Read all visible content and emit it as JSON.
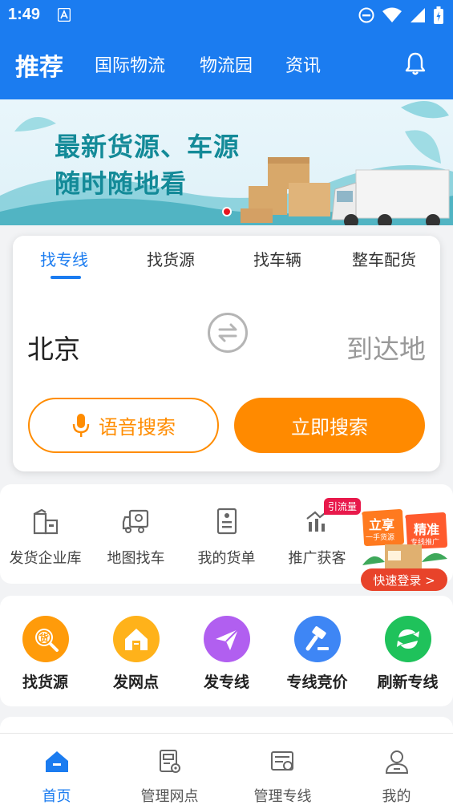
{
  "status_bar": {
    "time": "1:49"
  },
  "top_nav": {
    "tabs": [
      {
        "label": "推荐",
        "active": true
      },
      {
        "label": "国际物流",
        "active": false
      },
      {
        "label": "物流园",
        "active": false
      },
      {
        "label": "资讯",
        "active": false
      }
    ],
    "bell_icon": "bell-icon"
  },
  "banner": {
    "line1": "最新货源、车源",
    "line2": "随时随地看"
  },
  "search_card": {
    "tabs": [
      {
        "label": "找专线",
        "active": true
      },
      {
        "label": "找货源",
        "active": false
      },
      {
        "label": "找车辆",
        "active": false
      },
      {
        "label": "整车配货",
        "active": false
      }
    ],
    "from": "北京",
    "to_placeholder": "到达地",
    "voice_button": "语音搜索",
    "search_button": "立即搜索"
  },
  "tools": {
    "items": [
      {
        "label": "发货企业库",
        "icon": "building-icon"
      },
      {
        "label": "地图找车",
        "icon": "truck-map-icon"
      },
      {
        "label": "我的货单",
        "icon": "document-icon"
      },
      {
        "label": "推广获客",
        "icon": "chart-icon",
        "badge": "引流量"
      }
    ]
  },
  "promo": {
    "tag1": "立享",
    "tag1_sub": "一手货源",
    "tag2": "精准",
    "tag2_sub": "专线推广",
    "login": "快速登录 >"
  },
  "quick_actions": [
    {
      "label": "找货源",
      "color": "#ff9b0a",
      "icon": "cargo-search-icon"
    },
    {
      "label": "发网点",
      "color": "#ffb21a",
      "icon": "house-icon"
    },
    {
      "label": "发专线",
      "color": "#b15ff0",
      "icon": "paper-plane-icon"
    },
    {
      "label": "专线竞价",
      "color": "#3e86f5",
      "icon": "gavel-icon"
    },
    {
      "label": "刷新专线",
      "color": "#1fc25b",
      "icon": "refresh-icon"
    }
  ],
  "bottom_nav": [
    {
      "label": "首页",
      "active": true,
      "icon": "home-icon"
    },
    {
      "label": "管理网点",
      "active": false,
      "icon": "manage-outlet-icon"
    },
    {
      "label": "管理专线",
      "active": false,
      "icon": "manage-line-icon"
    },
    {
      "label": "我的",
      "active": false,
      "icon": "user-icon"
    }
  ],
  "colors": {
    "primary": "#1b7cf0",
    "accent": "#ff8a00",
    "badge": "#e8194b"
  }
}
